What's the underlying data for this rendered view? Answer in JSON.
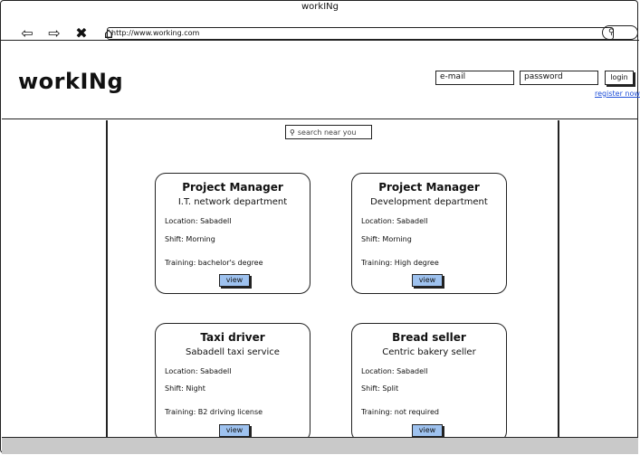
{
  "window": {
    "title": "workINg",
    "url": "http://www.working.com",
    "search_icon": "search-icon"
  },
  "header": {
    "logo": "workINg",
    "email_placeholder": "e-mail",
    "password_placeholder": "password",
    "login_label": "login",
    "register_label": "register now"
  },
  "search": {
    "placeholder": "search near you"
  },
  "cards": [
    {
      "title": "Project Manager",
      "subtitle": "I.T. network department",
      "location": "Location: Sabadell",
      "shift": "Shift: Morning",
      "training": "Training: bachelor's degree",
      "button": "view"
    },
    {
      "title": "Project Manager",
      "subtitle": "Development department",
      "location": "Location: Sabadell",
      "shift": "Shift: Morning",
      "training": "Training: High degree",
      "button": "view"
    },
    {
      "title": "Taxi driver",
      "subtitle": "Sabadell taxi service",
      "location": "Location: Sabadell",
      "shift": "Shift: Night",
      "training": "Training: B2 driving license",
      "button": "view"
    },
    {
      "title": "Bread seller",
      "subtitle": "Centric bakery seller",
      "location": "Location: Sabadell",
      "shift": "Shift: Split",
      "training": "Training: not required",
      "button": "view"
    }
  ],
  "colors": {
    "view_button": "#9ec2ef",
    "link": "#1d4ed8",
    "footer": "#c9c9c9"
  }
}
